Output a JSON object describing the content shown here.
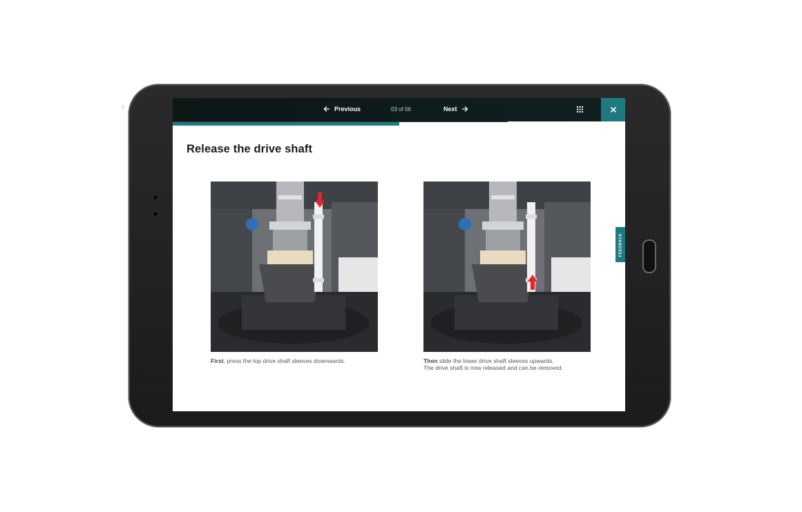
{
  "corner_mark": "L",
  "nav": {
    "previous_label": "Previous",
    "next_label": "Next",
    "counter": "03 of 06",
    "progress_fraction": 0.5
  },
  "page": {
    "title": "Release the drive shaft"
  },
  "steps": [
    {
      "caption_bold": "First",
      "caption_rest": ", press the top drive shaft sleeves downwards.",
      "caption_line2": "",
      "arrow_direction": "down"
    },
    {
      "caption_bold": "Then",
      "caption_rest": " slide the lower drive shaft sleeves upwards.",
      "caption_line2": "The drive shaft is now released and can be removed.",
      "arrow_direction": "up"
    }
  ],
  "feedback_label": "FEEDBACK",
  "icons": {
    "previous": "arrow-left-icon",
    "next": "arrow-right-icon",
    "menu": "grid-icon",
    "close": "close-icon"
  },
  "colors": {
    "accent": "#1e7a80",
    "topbar": "#0c1716",
    "arrow_red": "#e8232a"
  }
}
